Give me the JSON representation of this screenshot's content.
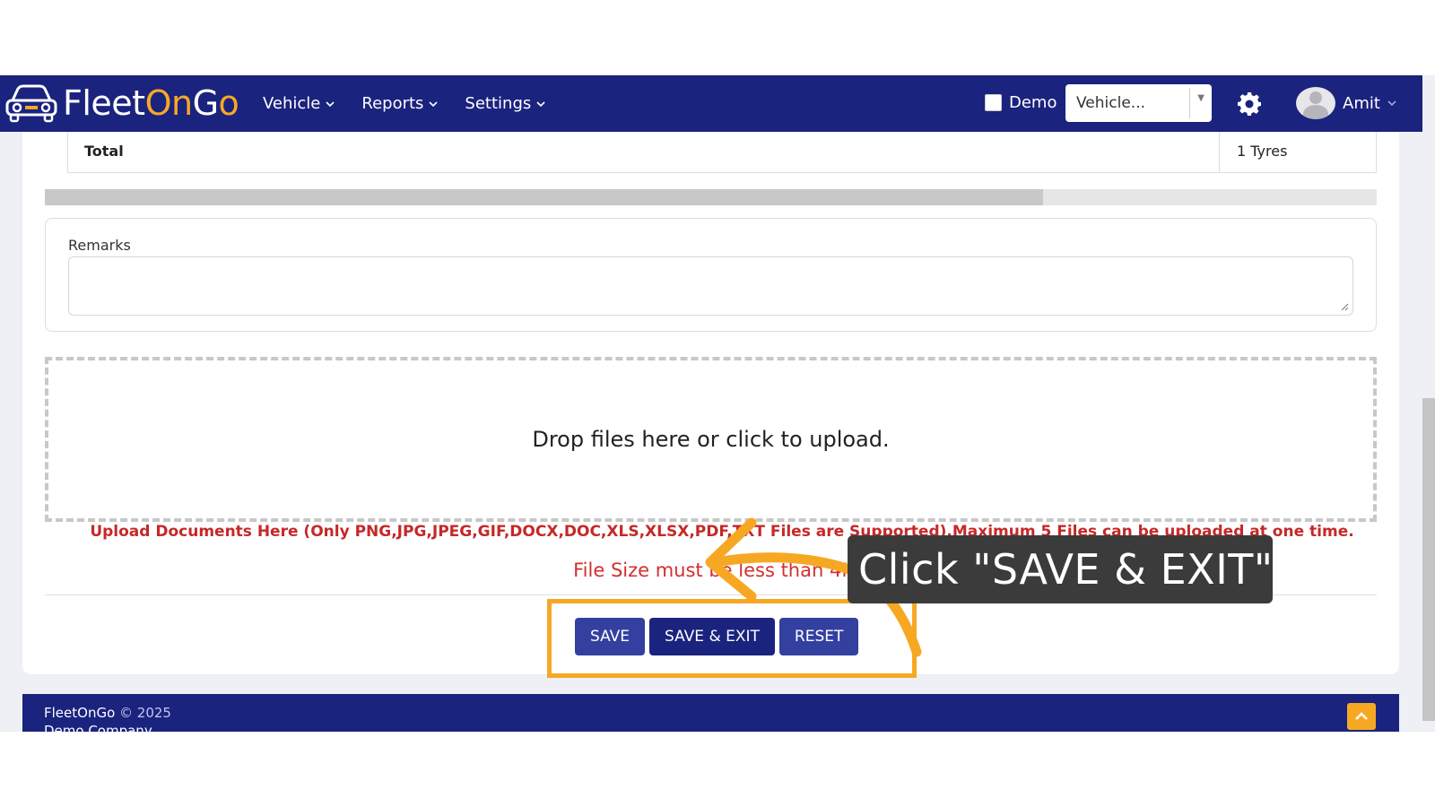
{
  "navbar": {
    "brand": {
      "part1": "Fleet",
      "part2": "On",
      "part3": "G",
      "part4": "o"
    },
    "menu": [
      {
        "label": "Vehicle"
      },
      {
        "label": "Reports"
      },
      {
        "label": "Settings"
      }
    ],
    "demo_label": "Demo",
    "vehicle_select": "Vehicle...",
    "user_name": "Amit"
  },
  "table": {
    "total_label": "Total",
    "total_value": "1 Tyres"
  },
  "remarks": {
    "label": "Remarks",
    "value": ""
  },
  "upload": {
    "dropzone_text": "Drop files here or click to upload.",
    "note": "Upload Documents Here (Only PNG,JPG,JPEG,GIF,DOCX,DOC,XLS,XLSX,PDF,TXT Files are Supported).Maximum 5 Files can be uploaded at one time.",
    "size_note": "File Size must be less than 4MB"
  },
  "actions": {
    "save": "SAVE",
    "save_exit": "SAVE & EXIT",
    "reset": "RESET"
  },
  "footer": {
    "brand": "FleetOnGo",
    "copyright": "© 2025",
    "company": "Demo Company"
  },
  "annotation": {
    "tooltip": "Click \"SAVE & EXIT\""
  },
  "colors": {
    "primary": "#1a237e",
    "accent": "#f7a823",
    "error": "#c62828"
  }
}
